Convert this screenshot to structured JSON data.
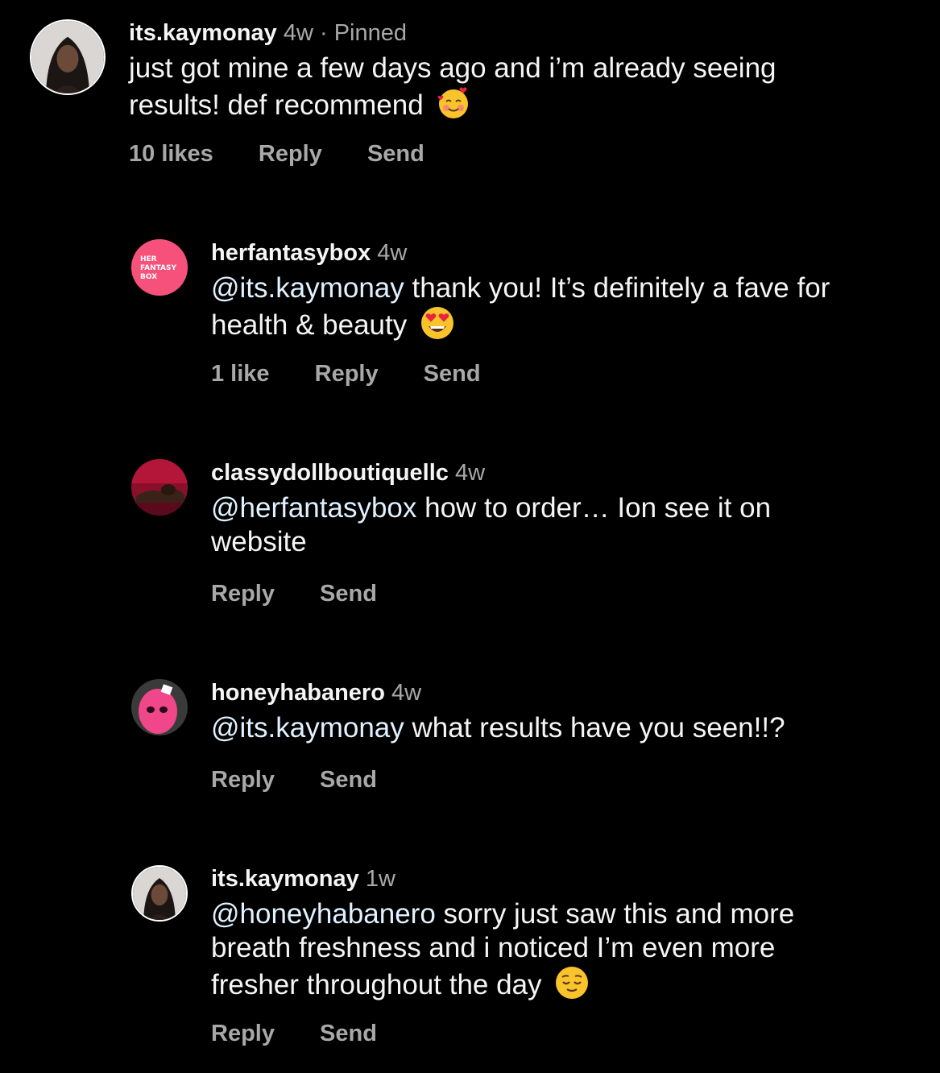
{
  "colors": {
    "background": "#000000",
    "text": "#f5f5f5",
    "secondary": "#a8a8a8",
    "mention": "#e0f1ff",
    "brand_pink": "#f5517a"
  },
  "comments": [
    {
      "username": "its.kaymonay",
      "time": "4w",
      "separator": "·",
      "pinned": "Pinned",
      "text": "just got mine a few days ago and i’m already seeing results! def recommend",
      "emoji": "smiling-face-with-hearts",
      "likes": "10 likes",
      "reply": "Reply",
      "send": "Send"
    },
    {
      "username": "herfantasybox",
      "time": "4w",
      "avatar_text": [
        "HER",
        "FANTASY",
        "BOX"
      ],
      "mention": "@its.kaymonay",
      "text": " thank you! It’s definitely a fave for health & beauty",
      "emoji": "heart-eyes-face",
      "likes": "1 like",
      "reply": "Reply",
      "send": "Send"
    },
    {
      "username": "classydollboutiquellc",
      "time": "4w",
      "mention": "@herfantasybox",
      "text": " how to order… Ion see it on website",
      "reply": "Reply",
      "send": "Send"
    },
    {
      "username": "honeyhabanero",
      "time": "4w",
      "mention": "@its.kaymonay",
      "text": " what results have you seen!!?",
      "reply": "Reply",
      "send": "Send"
    },
    {
      "username": "its.kaymonay",
      "time": "1w",
      "mention": "@honeyhabanero",
      "text": " sorry just saw this and more breath freshness and i noticed I’m even more fresher throughout the day",
      "emoji": "relieved-face",
      "reply": "Reply",
      "send": "Send"
    }
  ]
}
